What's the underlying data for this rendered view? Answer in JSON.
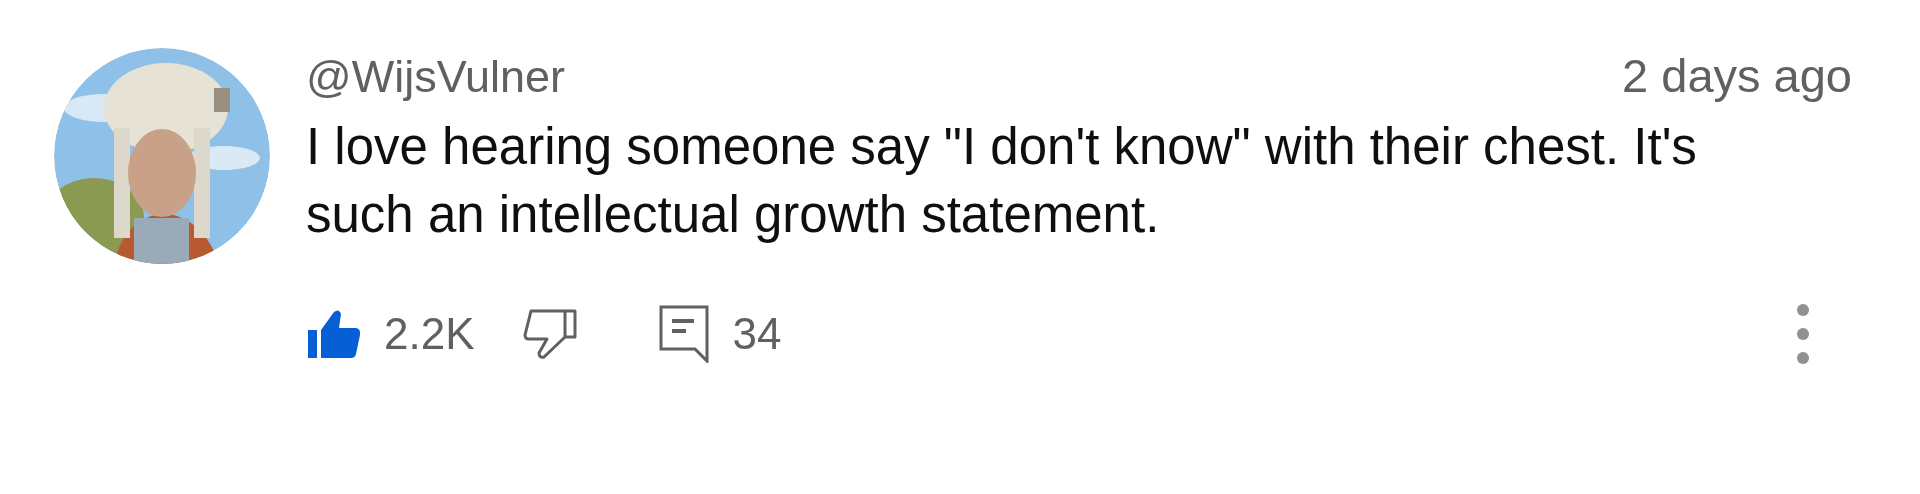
{
  "comment": {
    "author": "@WijsVulner",
    "time": "2 days ago",
    "text": "I love hearing someone say \"I don't know\" with their chest. It's such an intellectual growth statement.",
    "likes": "2.2K",
    "liked": true,
    "disliked": false,
    "replies": "34"
  }
}
